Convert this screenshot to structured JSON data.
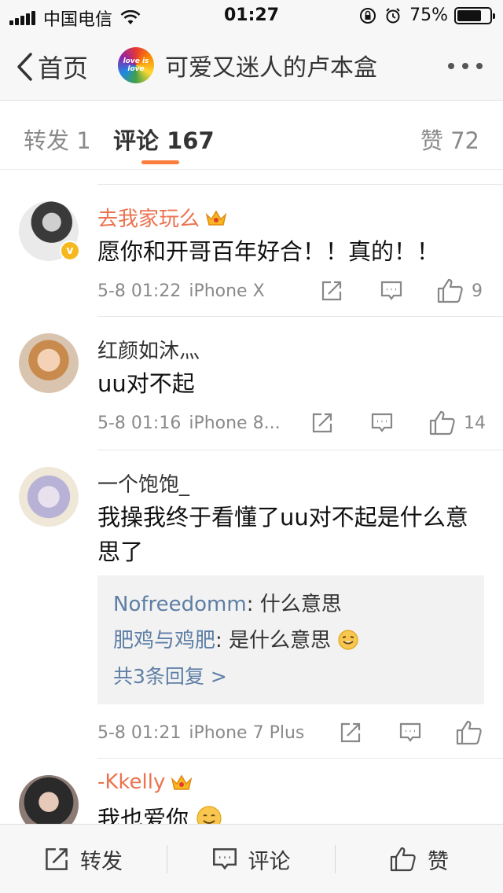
{
  "status_bar": {
    "carrier": "中国电信",
    "time": "01:27",
    "battery": "75%",
    "battery_level": 0.75
  },
  "nav": {
    "back_label": "首页",
    "title": "可爱又迷人的卢本盒",
    "avatar_text": "love is love"
  },
  "tabs": {
    "repost": "转发 1",
    "comments": "评论 167",
    "likes": "赞 72"
  },
  "comments": [
    {
      "name": "去我家玩么",
      "text": "愿你和开哥百年好合！！真的！！",
      "time": "5-8 01:22",
      "source": "iPhone X",
      "likes": "9"
    },
    {
      "name": "红颜如沐灬",
      "text": "uu对不起",
      "time": "5-8 01:16",
      "source": "iPhone 8...",
      "likes": "14"
    },
    {
      "name": "一个饱饱_",
      "text": "我操我终于看懂了uu对不起是什么意思了",
      "replies": [
        {
          "name": "Nofreedomm",
          "text": ": 什么意思"
        },
        {
          "name": "肥鸡与鸡肥",
          "text": ": 是什么意思"
        }
      ],
      "more_replies": "共3条回复 >",
      "time": "5-8 01:21",
      "source": "iPhone 7 Plus",
      "likes": ""
    },
    {
      "name": "-Kkelly",
      "text": "我也爱你"
    }
  ],
  "bottom_bar": {
    "repost": "转发",
    "comment": "评论",
    "like": "赞"
  },
  "colors": {
    "accent": "#fa7d3c",
    "vip_name": "#eb7350",
    "reply_name": "#5d7ea6"
  }
}
